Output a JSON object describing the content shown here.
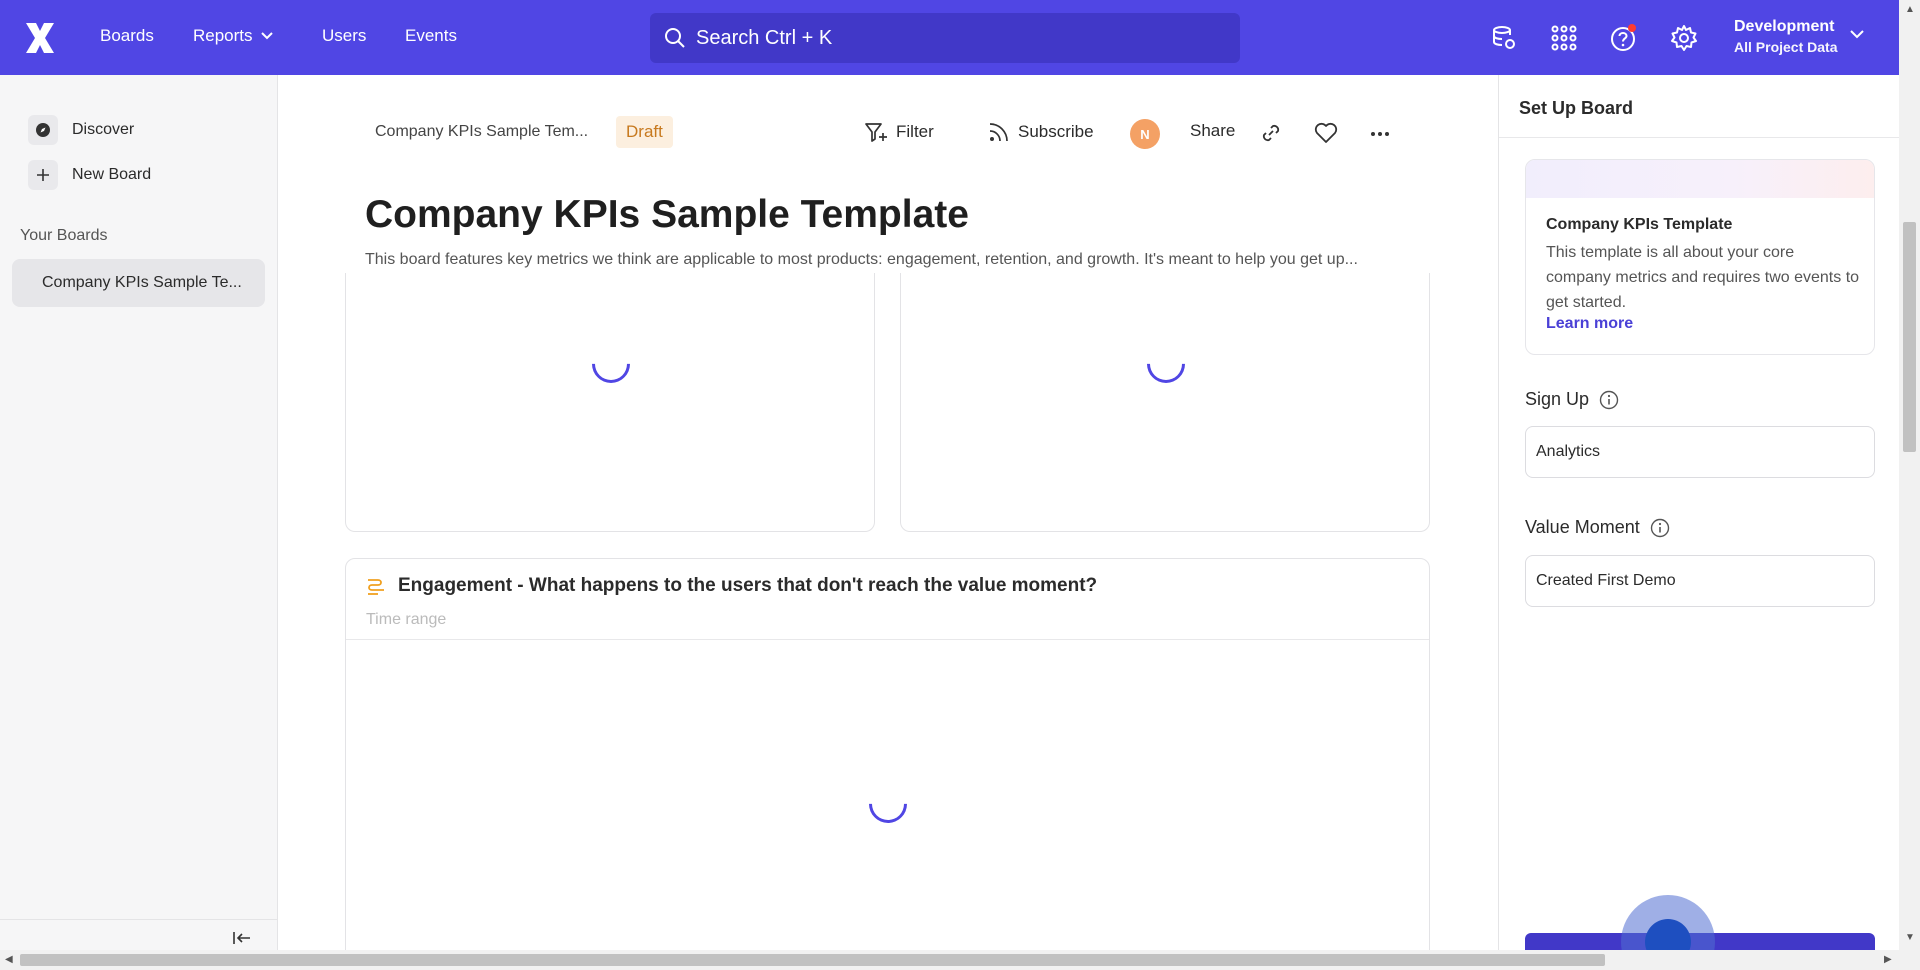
{
  "topnav": {
    "links": {
      "boards": "Boards",
      "reports": "Reports",
      "users": "Users",
      "events": "Events"
    },
    "search_text": "Search  Ctrl + K",
    "project_name": "Development",
    "project_scope": "All Project Data"
  },
  "sidebar": {
    "discover": "Discover",
    "new_board": "New Board",
    "section_title": "Your Boards",
    "board_item": "Company KPIs Sample Te..."
  },
  "main": {
    "breadcrumb": "Company KPIs Sample Tem...",
    "status": "Draft",
    "toolbar": {
      "filter": "Filter",
      "subscribe": "Subscribe",
      "avatar_initial": "N",
      "share": "Share"
    },
    "title": "Company KPIs Sample Template",
    "description": "This board features key metrics we think are applicable to most products: engagement, retention, and growth. It's meant to help you get up...",
    "card": {
      "title": "Engagement - What happens to the users that don't reach the value moment?",
      "subtitle": "Time range"
    }
  },
  "right_panel": {
    "title": "Set Up Board",
    "template": {
      "name": "Company KPIs Template",
      "description": "This template is all about your core company metrics and requires two events to get started.",
      "link": "Learn more"
    },
    "fields": [
      {
        "label": "Sign Up",
        "value": "Analytics"
      },
      {
        "label": "Value Moment",
        "value": "Created First Demo"
      }
    ]
  },
  "colors": {
    "brand": "#5046e4",
    "draft_bg": "#fcefdf",
    "draft_text": "#c7791e",
    "avatar": "#f4a165"
  }
}
